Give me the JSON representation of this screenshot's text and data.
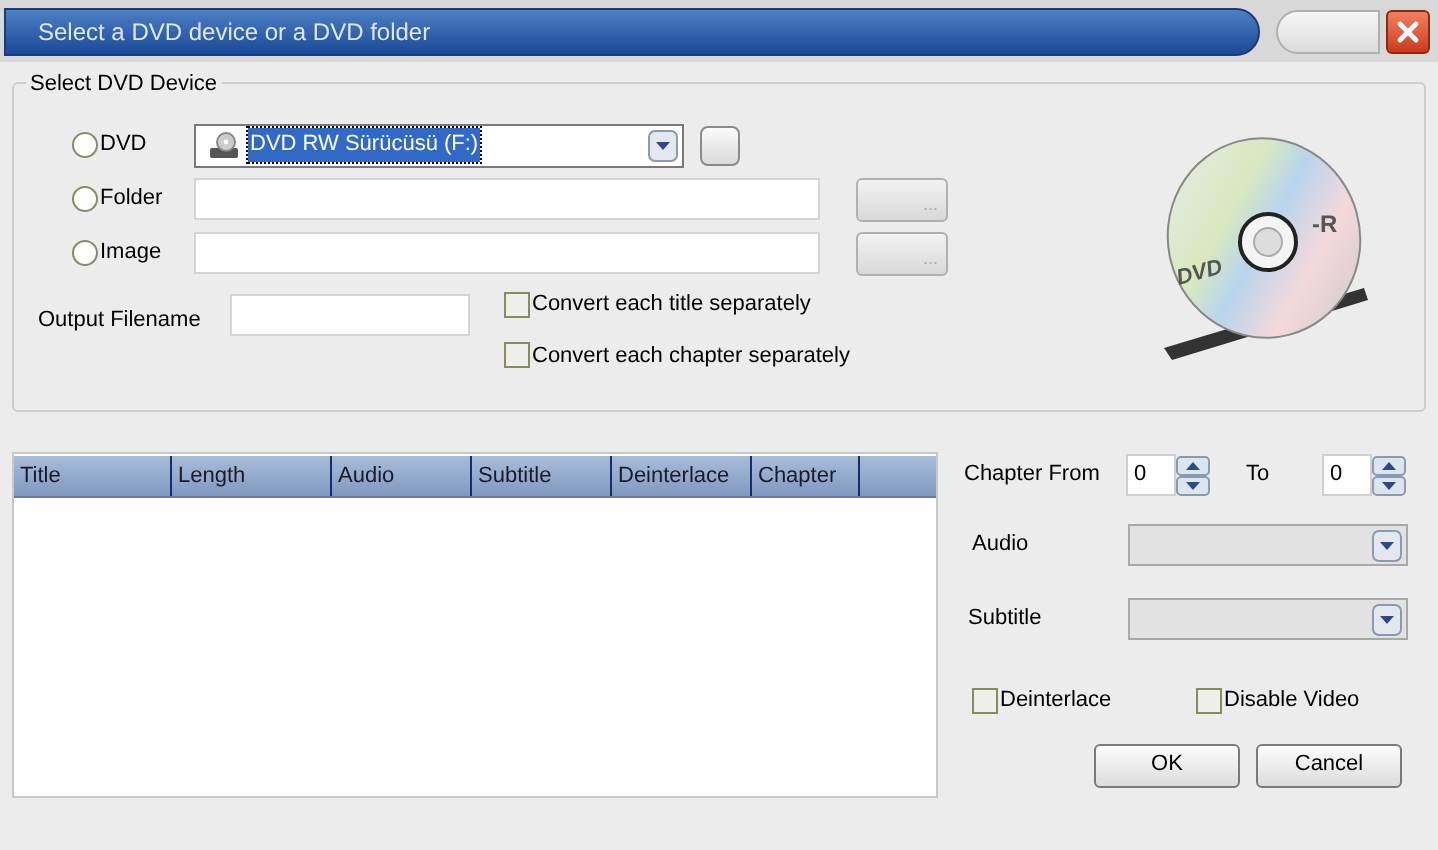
{
  "window": {
    "title": "Select a DVD device or a DVD folder"
  },
  "device_group": {
    "title": "Select DVD Device",
    "sources": [
      {
        "kind": "combo",
        "label": "DVD",
        "selected": false,
        "value": "DVD RW Sürücüsü (F:)",
        "highlighted": true
      },
      {
        "kind": "path",
        "label": "Folder",
        "selected": false,
        "browse": "...",
        "browse_disabled": true
      },
      {
        "kind": "path",
        "label": "Image",
        "selected": false,
        "browse": "...",
        "browse_disabled": true
      }
    ]
  },
  "output_filename": {
    "label": "Output Filename"
  },
  "options": [
    {
      "label": "Convert each title separately",
      "checked": false
    },
    {
      "label": "Convert each chapter separately",
      "checked": false
    }
  ],
  "disc_art": {
    "left_mark": "DVD",
    "right_mark": "-R"
  },
  "title_list": {
    "columns": [
      "Title",
      "Length",
      "Audio",
      "Subtitle",
      "Deinterlace",
      "Chapter"
    ]
  },
  "chapter_range": {
    "from_label": "Chapter From",
    "from_value": "0",
    "to_label": "To",
    "to_value": "0"
  },
  "audio": {
    "label": "Audio",
    "disabled": true
  },
  "subtitle": {
    "label": "Subtitle",
    "disabled": true
  },
  "stream_options": [
    {
      "label": "Deinterlace",
      "checked": false
    },
    {
      "label": "Disable Video",
      "checked": false
    }
  ],
  "buttons": [
    "OK",
    "Cancel"
  ]
}
